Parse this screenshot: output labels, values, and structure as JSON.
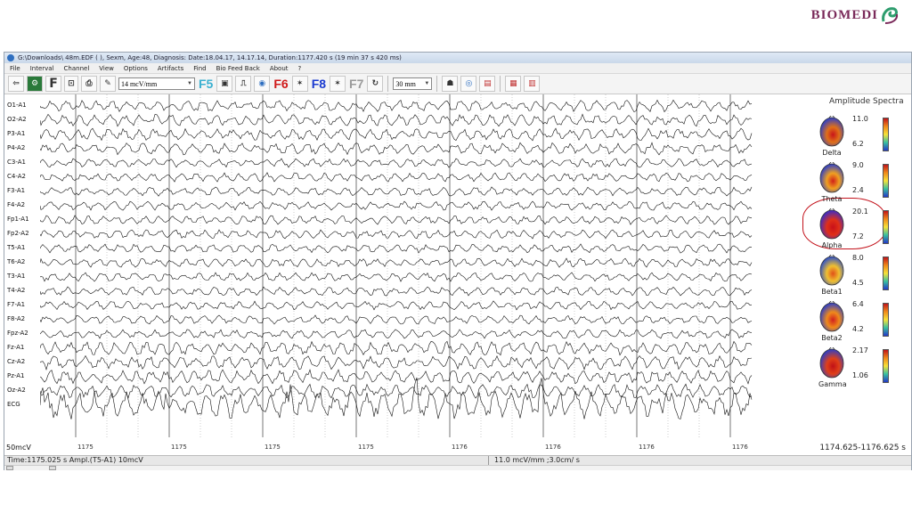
{
  "brand": {
    "name": "BIOMEDI"
  },
  "window": {
    "title": "G:\\Downloads\\                    48m.EDF (                                    ), Sexm, Age:48, Diagnosis:   Date:18.04.17, 14.17.14, Duration:1177.420 s (19 min 37 s 420 ms)",
    "menu": [
      "File",
      "Interval",
      "Channel",
      "View",
      "Options",
      "Artifacts",
      "Find",
      "Bio Feed Back",
      "About",
      "?"
    ]
  },
  "toolbar": {
    "sensitivity": "14 mcV/mm",
    "timebase": "30 mm",
    "fkeys": [
      "F5",
      "F6",
      "F8",
      "F7"
    ]
  },
  "channels": [
    "O1-A1",
    "O2-A2",
    "P3-A1",
    "P4-A2",
    "C3-A1",
    "C4-A2",
    "F3-A1",
    "F4-A2",
    "Fp1-A1",
    "Fp2-A2",
    "T5-A1",
    "T6-A2",
    "T3-A1",
    "T4-A2",
    "F7-A1",
    "F8-A2",
    "Fpz-A2",
    "Fz-A1",
    "Cz-A2",
    "Pz-A1",
    "Oz-A2",
    "ECG"
  ],
  "time_ticks": [
    "1175",
    "1175",
    "1175",
    "1175",
    "1176",
    "1176",
    "1176",
    "1176"
  ],
  "amplitude_spectra": {
    "title": "Amplitude Spectra",
    "bands": [
      {
        "name": "Delta",
        "max": "11.0",
        "min": "6.2"
      },
      {
        "name": "Theta",
        "max": "9.0",
        "min": "2.4"
      },
      {
        "name": "Alpha",
        "max": "20.1",
        "min": "7.2",
        "highlighted": true
      },
      {
        "name": "Beta1",
        "max": "8.0",
        "min": "4.5"
      },
      {
        "name": "Beta2",
        "max": "6.4",
        "min": "4.2"
      },
      {
        "name": "Gamma",
        "max": "2.17",
        "min": "1.06"
      }
    ]
  },
  "scale_label": "50mcV",
  "time_range": "1174.625-1176.625 s",
  "status": {
    "left": "Time:1175.025 s Ampl.(T5-A1) 10mcV",
    "right": "11.0 mcV/mm ;3.0cm/ s"
  }
}
